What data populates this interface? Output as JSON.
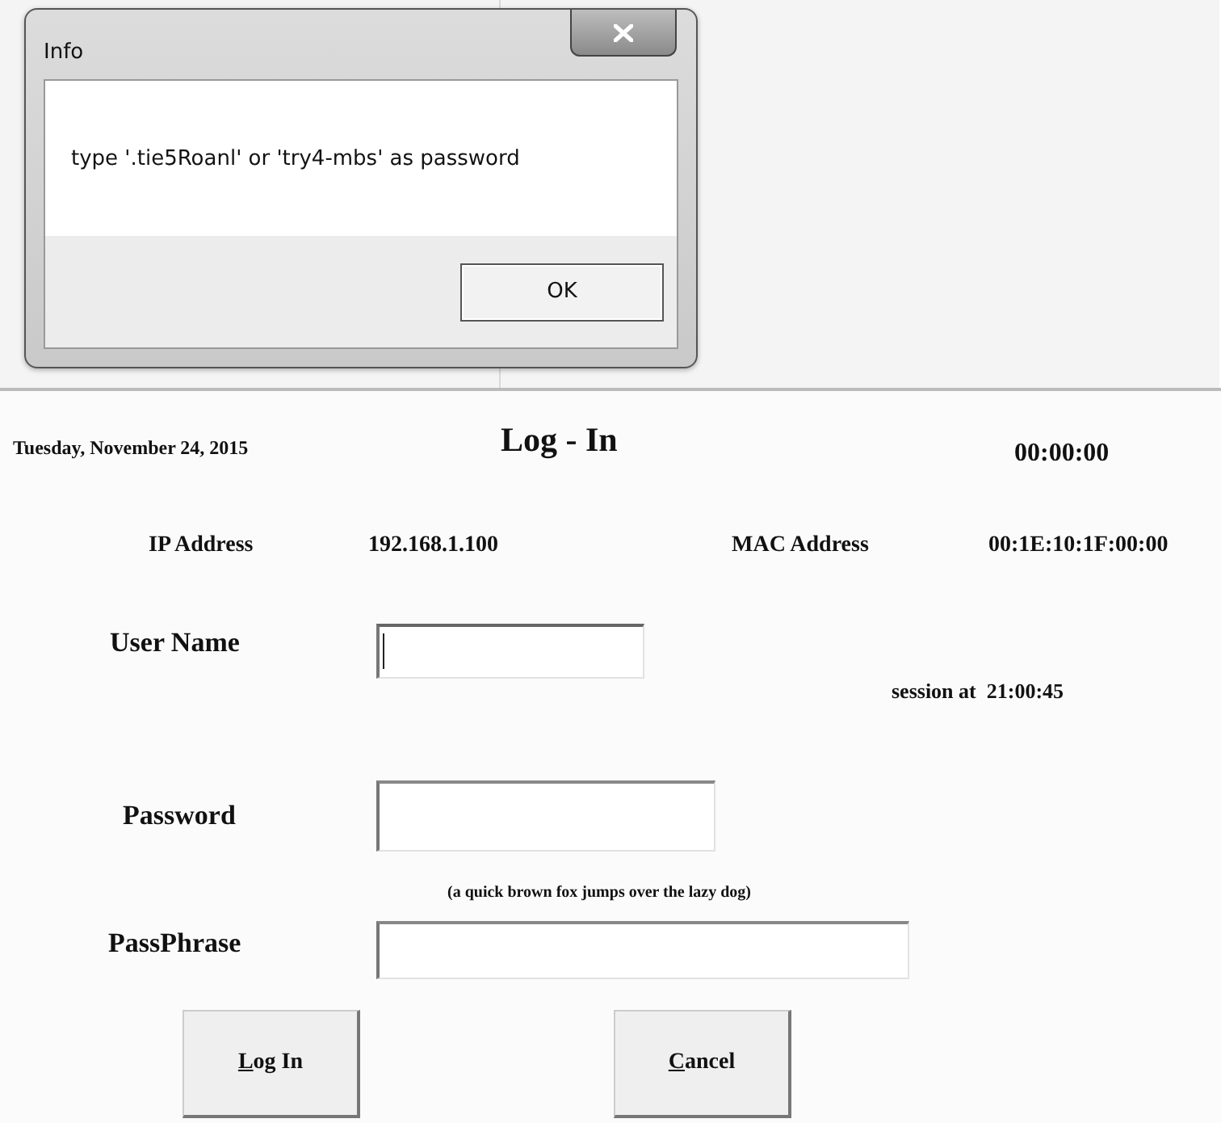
{
  "dialog": {
    "title": "Info",
    "message": "type '.tie5Roanl' or 'try4-mbs' as password",
    "buttons": [
      "OK"
    ]
  },
  "header": {
    "date": "Tuesday, November 24, 2015",
    "title": "Log - In",
    "clock": "00:00:00"
  },
  "network": [
    {
      "label": "IP Address",
      "value": "192.168.1.100"
    },
    {
      "label": "MAC Address",
      "value": "00:1E:10:1F:00:00"
    }
  ],
  "fields": [
    {
      "label": "User Name",
      "focused": true
    },
    {
      "label": "Password",
      "focused": false
    },
    {
      "label": "PassPhrase",
      "focused": false
    }
  ],
  "session": "session at  21:00:45",
  "passphrase_hint": "(a quick brown fox jumps over the lazy dog)",
  "buttons": [
    {
      "label": "Log In"
    },
    {
      "label": "Cancel"
    }
  ]
}
